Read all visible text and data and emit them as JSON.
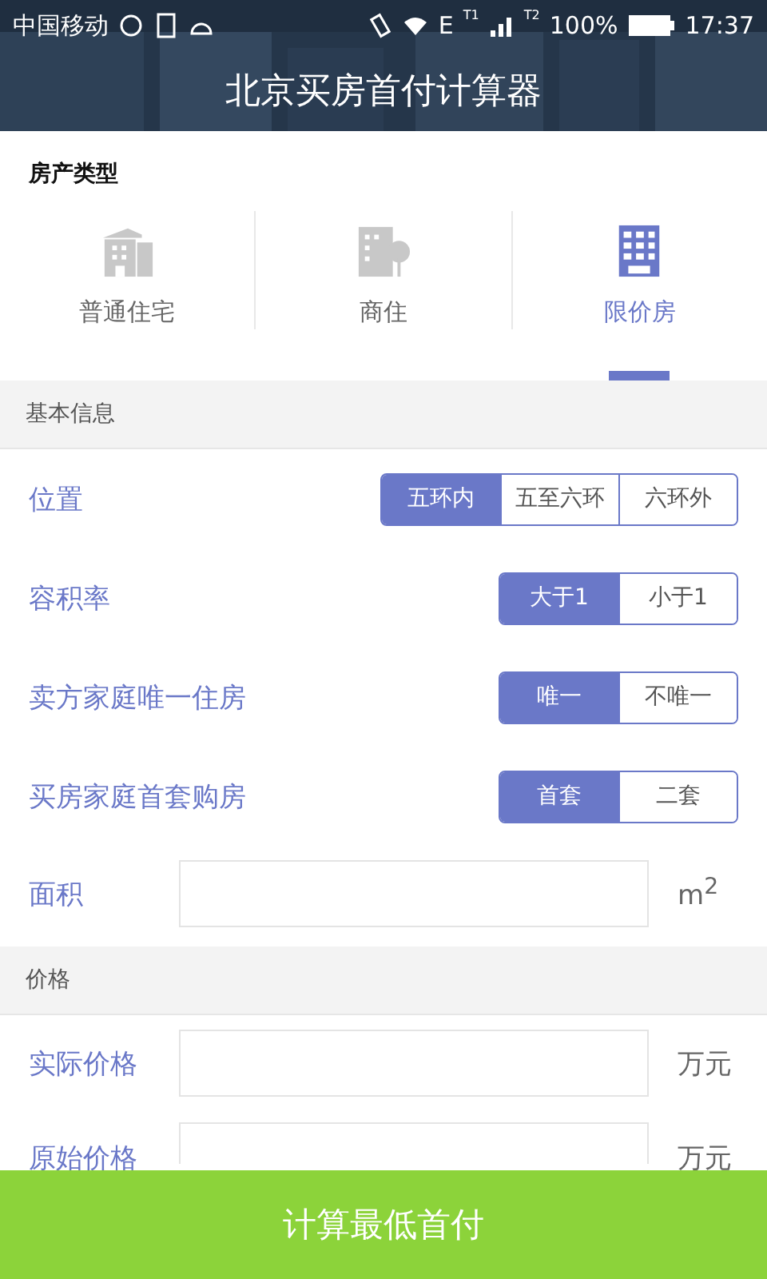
{
  "status_bar": {
    "carrier": "中国移动",
    "network": "E",
    "sim1": "T1",
    "sim2": "T2",
    "battery": "100%",
    "time": "17:37"
  },
  "header": {
    "title": "北京买房首付计算器"
  },
  "property_type": {
    "label": "房产类型",
    "tabs": [
      {
        "label": "普通住宅",
        "kind": "house",
        "selected": false
      },
      {
        "label": "商住",
        "kind": "office",
        "selected": false
      },
      {
        "label": "限价房",
        "kind": "apartment",
        "selected": true
      }
    ]
  },
  "sections": [
    {
      "title": "基本信息",
      "rows": [
        {
          "kind": "segmented",
          "label": "位置",
          "options": [
            {
              "label": "五环内",
              "selected": true
            },
            {
              "label": "五至六环",
              "selected": false
            },
            {
              "label": "六环外",
              "selected": false
            }
          ]
        },
        {
          "kind": "segmented",
          "label": "容积率",
          "options": [
            {
              "label": "大于1",
              "selected": true
            },
            {
              "label": "小于1",
              "selected": false
            }
          ]
        },
        {
          "kind": "segmented",
          "label": "卖方家庭唯一住房",
          "options": [
            {
              "label": "唯一",
              "selected": true
            },
            {
              "label": "不唯一",
              "selected": false
            }
          ]
        },
        {
          "kind": "segmented",
          "label": "买房家庭首套购房",
          "options": [
            {
              "label": "首套",
              "selected": true
            },
            {
              "label": "二套",
              "selected": false
            }
          ]
        },
        {
          "kind": "input",
          "label": "面积",
          "unit": "m$^{2}$"
        }
      ]
    },
    {
      "title": "价格",
      "rows": [
        {
          "kind": "input",
          "label": "实际价格",
          "unit": "万元"
        },
        {
          "kind": "input",
          "label": "原始价格",
          "unit": "万元"
        }
      ]
    }
  ],
  "action_button": "计算最低首付"
}
